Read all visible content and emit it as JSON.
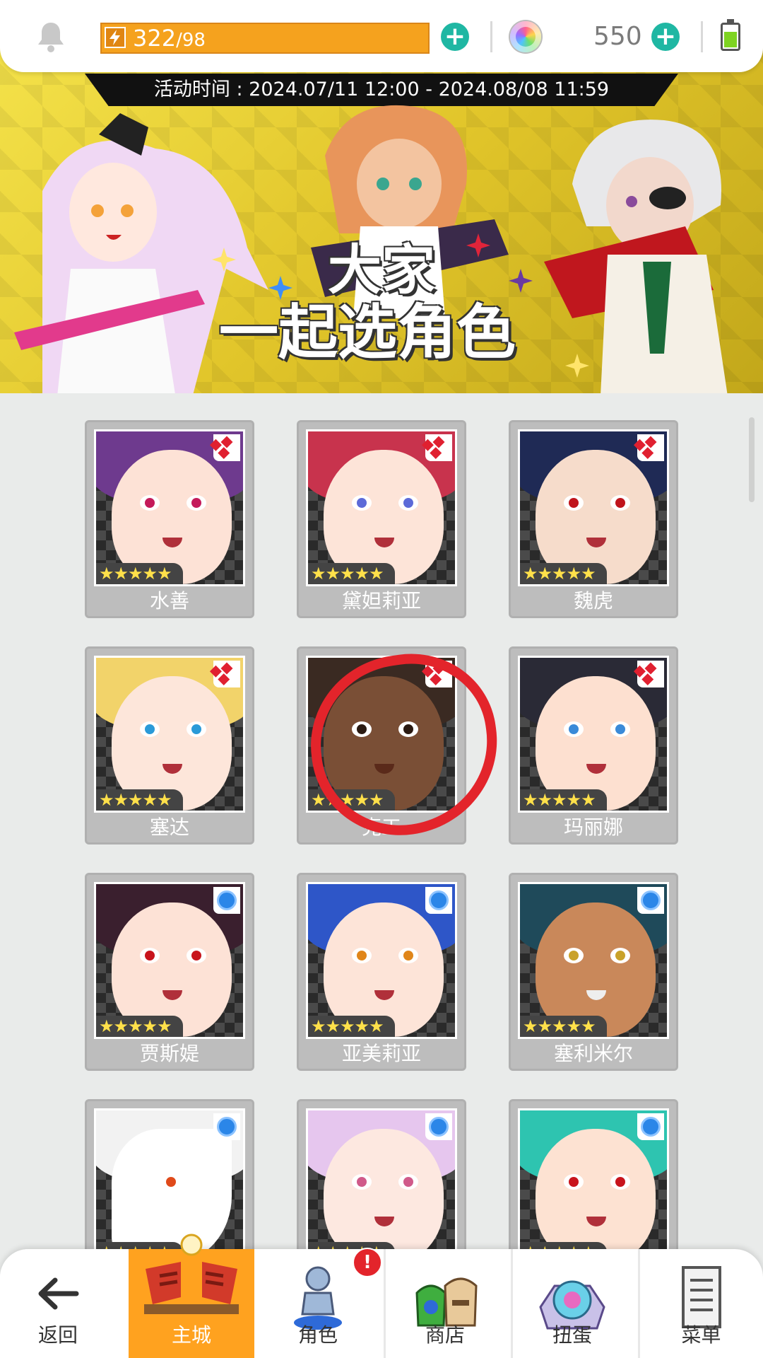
{
  "status_bar": {
    "energy_current": "322",
    "energy_max": "/98",
    "gem_count": "550"
  },
  "banner": {
    "event_time": "活动时间 : 2024.07/11 12:00 - 2024.08/08 11:59",
    "title_line1": "大家",
    "title_line2": "一起选角色"
  },
  "characters": [
    {
      "name": "水善",
      "rank": "diamond",
      "stars": "★★★★★"
    },
    {
      "name": "黛妲莉亚",
      "rank": "diamond",
      "stars": "★★★★★"
    },
    {
      "name": "魏虎",
      "rank": "diamond",
      "stars": "★★★★★"
    },
    {
      "name": "塞达",
      "rank": "diamond",
      "stars": "★★★★★"
    },
    {
      "name": "克工",
      "rank": "diamond",
      "stars": "★★★★★"
    },
    {
      "name": "玛丽娜",
      "rank": "diamond",
      "stars": "★★★★★"
    },
    {
      "name": "贾斯媞",
      "rank": "circle",
      "stars": "★★★★★"
    },
    {
      "name": "亚美莉亚",
      "rank": "circle",
      "stars": "★★★★★"
    },
    {
      "name": "塞利米尔",
      "rank": "circle",
      "stars": "★★★★★"
    },
    {
      "name": "",
      "rank": "circle",
      "stars": "★★★★★"
    },
    {
      "name": "",
      "rank": "circle",
      "stars": "★★★★★"
    },
    {
      "name": "",
      "rank": "circle",
      "stars": "★★★★★"
    }
  ],
  "bottom_nav": {
    "back": "返回",
    "main_city": "主城",
    "character": "角色",
    "character_badge": "!",
    "shop": "商店",
    "gacha": "扭蛋",
    "menu": "菜单"
  },
  "colors": {
    "accent_orange": "#ffa21f",
    "plus_teal": "#1fb7a3",
    "annotation_red": "#e3242b"
  },
  "icons": [
    "bell-icon",
    "lightning-icon",
    "plus-icon",
    "rainbow-orb-icon",
    "battery-icon",
    "back-arrow-icon",
    "castle-icon",
    "character-figure-icon",
    "shop-bags-icon",
    "gacha-machine-icon",
    "menu-list-icon"
  ]
}
